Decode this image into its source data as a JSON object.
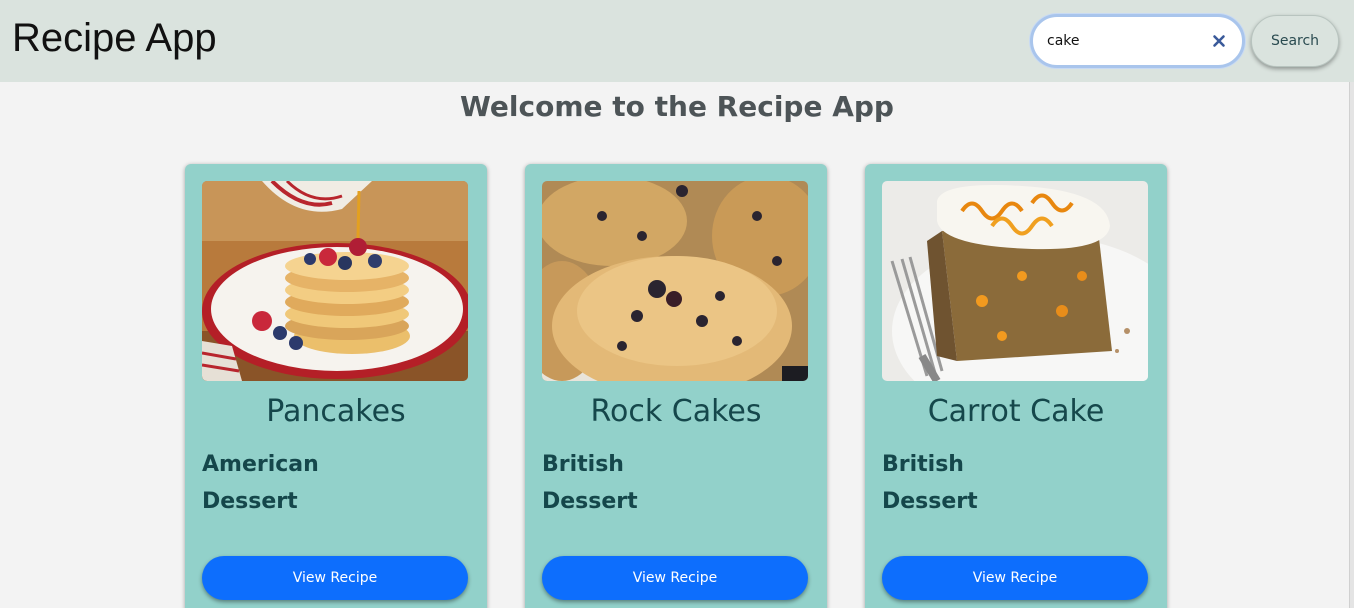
{
  "header": {
    "title": "Recipe App",
    "search_value": "cake",
    "search_button_label": "Search"
  },
  "main": {
    "welcome": "Welcome to the Recipe App",
    "recipes": [
      {
        "name": "Pancakes",
        "area": "American",
        "category": "Dessert",
        "button_label": "View Recipe",
        "image": "pancakes-photo"
      },
      {
        "name": "Rock Cakes",
        "area": "British",
        "category": "Dessert",
        "button_label": "View Recipe",
        "image": "rock-cakes-photo"
      },
      {
        "name": "Carrot Cake",
        "area": "British",
        "category": "Dessert",
        "button_label": "View Recipe",
        "image": "carrot-cake-photo"
      }
    ]
  },
  "colors": {
    "header_bg": "#dae3de",
    "page_bg": "#f3f3f3",
    "card_bg": "#92d1ca",
    "card_text": "#15474b",
    "button_blue": "#0d6efd"
  },
  "icons": {
    "clear": "close-icon"
  }
}
